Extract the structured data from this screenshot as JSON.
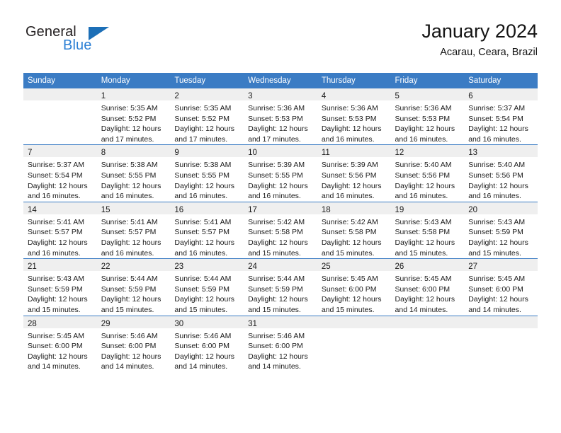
{
  "logo": {
    "text_top": "General",
    "text_bottom": "Blue",
    "triangle_icon": "triangle-icon",
    "color_dark": "#231f20",
    "color_blue": "#2b7fd4"
  },
  "header": {
    "title": "January 2024",
    "subtitle": "Acarau, Ceara, Brazil"
  },
  "theme": {
    "header_blue": "#3b7cc4",
    "daynum_band": "#efefef",
    "text": "#1a1a1a"
  },
  "calendar": {
    "weekday_headers": [
      "Sunday",
      "Monday",
      "Tuesday",
      "Wednesday",
      "Thursday",
      "Friday",
      "Saturday"
    ],
    "weeks": [
      [
        {
          "day": "",
          "lines": []
        },
        {
          "day": "1",
          "lines": [
            "Sunrise: 5:35 AM",
            "Sunset: 5:52 PM",
            "Daylight: 12 hours",
            "and 17 minutes."
          ]
        },
        {
          "day": "2",
          "lines": [
            "Sunrise: 5:35 AM",
            "Sunset: 5:52 PM",
            "Daylight: 12 hours",
            "and 17 minutes."
          ]
        },
        {
          "day": "3",
          "lines": [
            "Sunrise: 5:36 AM",
            "Sunset: 5:53 PM",
            "Daylight: 12 hours",
            "and 17 minutes."
          ]
        },
        {
          "day": "4",
          "lines": [
            "Sunrise: 5:36 AM",
            "Sunset: 5:53 PM",
            "Daylight: 12 hours",
            "and 16 minutes."
          ]
        },
        {
          "day": "5",
          "lines": [
            "Sunrise: 5:36 AM",
            "Sunset: 5:53 PM",
            "Daylight: 12 hours",
            "and 16 minutes."
          ]
        },
        {
          "day": "6",
          "lines": [
            "Sunrise: 5:37 AM",
            "Sunset: 5:54 PM",
            "Daylight: 12 hours",
            "and 16 minutes."
          ]
        }
      ],
      [
        {
          "day": "7",
          "lines": [
            "Sunrise: 5:37 AM",
            "Sunset: 5:54 PM",
            "Daylight: 12 hours",
            "and 16 minutes."
          ]
        },
        {
          "day": "8",
          "lines": [
            "Sunrise: 5:38 AM",
            "Sunset: 5:55 PM",
            "Daylight: 12 hours",
            "and 16 minutes."
          ]
        },
        {
          "day": "9",
          "lines": [
            "Sunrise: 5:38 AM",
            "Sunset: 5:55 PM",
            "Daylight: 12 hours",
            "and 16 minutes."
          ]
        },
        {
          "day": "10",
          "lines": [
            "Sunrise: 5:39 AM",
            "Sunset: 5:55 PM",
            "Daylight: 12 hours",
            "and 16 minutes."
          ]
        },
        {
          "day": "11",
          "lines": [
            "Sunrise: 5:39 AM",
            "Sunset: 5:56 PM",
            "Daylight: 12 hours",
            "and 16 minutes."
          ]
        },
        {
          "day": "12",
          "lines": [
            "Sunrise: 5:40 AM",
            "Sunset: 5:56 PM",
            "Daylight: 12 hours",
            "and 16 minutes."
          ]
        },
        {
          "day": "13",
          "lines": [
            "Sunrise: 5:40 AM",
            "Sunset: 5:56 PM",
            "Daylight: 12 hours",
            "and 16 minutes."
          ]
        }
      ],
      [
        {
          "day": "14",
          "lines": [
            "Sunrise: 5:41 AM",
            "Sunset: 5:57 PM",
            "Daylight: 12 hours",
            "and 16 minutes."
          ]
        },
        {
          "day": "15",
          "lines": [
            "Sunrise: 5:41 AM",
            "Sunset: 5:57 PM",
            "Daylight: 12 hours",
            "and 16 minutes."
          ]
        },
        {
          "day": "16",
          "lines": [
            "Sunrise: 5:41 AM",
            "Sunset: 5:57 PM",
            "Daylight: 12 hours",
            "and 16 minutes."
          ]
        },
        {
          "day": "17",
          "lines": [
            "Sunrise: 5:42 AM",
            "Sunset: 5:58 PM",
            "Daylight: 12 hours",
            "and 15 minutes."
          ]
        },
        {
          "day": "18",
          "lines": [
            "Sunrise: 5:42 AM",
            "Sunset: 5:58 PM",
            "Daylight: 12 hours",
            "and 15 minutes."
          ]
        },
        {
          "day": "19",
          "lines": [
            "Sunrise: 5:43 AM",
            "Sunset: 5:58 PM",
            "Daylight: 12 hours",
            "and 15 minutes."
          ]
        },
        {
          "day": "20",
          "lines": [
            "Sunrise: 5:43 AM",
            "Sunset: 5:59 PM",
            "Daylight: 12 hours",
            "and 15 minutes."
          ]
        }
      ],
      [
        {
          "day": "21",
          "lines": [
            "Sunrise: 5:43 AM",
            "Sunset: 5:59 PM",
            "Daylight: 12 hours",
            "and 15 minutes."
          ]
        },
        {
          "day": "22",
          "lines": [
            "Sunrise: 5:44 AM",
            "Sunset: 5:59 PM",
            "Daylight: 12 hours",
            "and 15 minutes."
          ]
        },
        {
          "day": "23",
          "lines": [
            "Sunrise: 5:44 AM",
            "Sunset: 5:59 PM",
            "Daylight: 12 hours",
            "and 15 minutes."
          ]
        },
        {
          "day": "24",
          "lines": [
            "Sunrise: 5:44 AM",
            "Sunset: 5:59 PM",
            "Daylight: 12 hours",
            "and 15 minutes."
          ]
        },
        {
          "day": "25",
          "lines": [
            "Sunrise: 5:45 AM",
            "Sunset: 6:00 PM",
            "Daylight: 12 hours",
            "and 15 minutes."
          ]
        },
        {
          "day": "26",
          "lines": [
            "Sunrise: 5:45 AM",
            "Sunset: 6:00 PM",
            "Daylight: 12 hours",
            "and 14 minutes."
          ]
        },
        {
          "day": "27",
          "lines": [
            "Sunrise: 5:45 AM",
            "Sunset: 6:00 PM",
            "Daylight: 12 hours",
            "and 14 minutes."
          ]
        }
      ],
      [
        {
          "day": "28",
          "lines": [
            "Sunrise: 5:45 AM",
            "Sunset: 6:00 PM",
            "Daylight: 12 hours",
            "and 14 minutes."
          ]
        },
        {
          "day": "29",
          "lines": [
            "Sunrise: 5:46 AM",
            "Sunset: 6:00 PM",
            "Daylight: 12 hours",
            "and 14 minutes."
          ]
        },
        {
          "day": "30",
          "lines": [
            "Sunrise: 5:46 AM",
            "Sunset: 6:00 PM",
            "Daylight: 12 hours",
            "and 14 minutes."
          ]
        },
        {
          "day": "31",
          "lines": [
            "Sunrise: 5:46 AM",
            "Sunset: 6:00 PM",
            "Daylight: 12 hours",
            "and 14 minutes."
          ]
        },
        {
          "day": "",
          "lines": []
        },
        {
          "day": "",
          "lines": []
        },
        {
          "day": "",
          "lines": []
        }
      ]
    ]
  }
}
